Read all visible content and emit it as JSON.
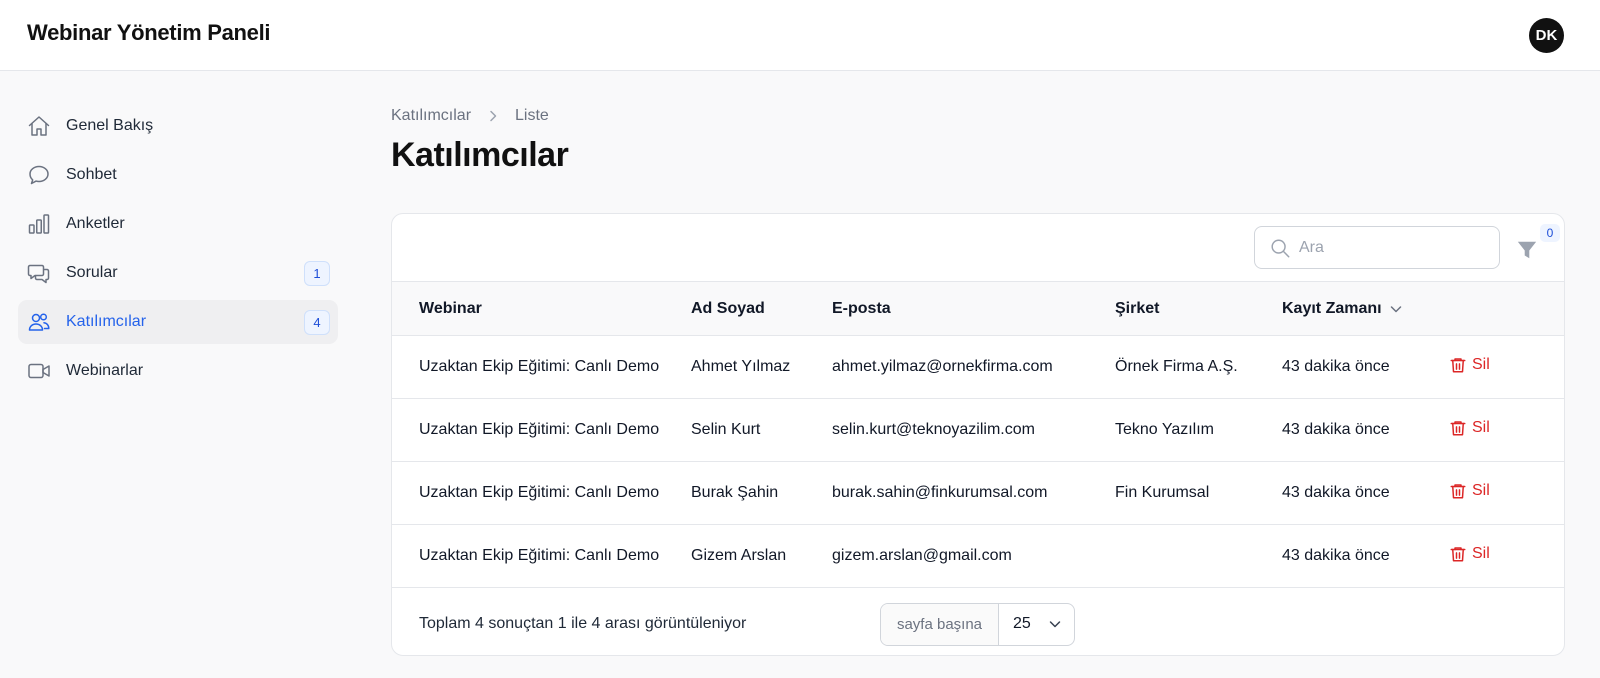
{
  "app": {
    "title": "Webinar Yönetim Paneli",
    "avatar_initials": "DK"
  },
  "sidebar": {
    "items": [
      {
        "label": "Genel Bakış",
        "icon": "home-icon",
        "badge": null
      },
      {
        "label": "Sohbet",
        "icon": "chat-bubble-icon",
        "badge": null
      },
      {
        "label": "Anketler",
        "icon": "bar-chart-icon",
        "badge": null
      },
      {
        "label": "Sorular",
        "icon": "question-chat-icon",
        "badge": "1"
      },
      {
        "label": "Katılımcılar",
        "icon": "users-icon",
        "badge": "4",
        "active": true
      },
      {
        "label": "Webinarlar",
        "icon": "video-camera-icon",
        "badge": null
      }
    ]
  },
  "breadcrumb": {
    "parent": "Katılımcılar",
    "current": "Liste"
  },
  "page": {
    "title": "Katılımcılar"
  },
  "toolbar": {
    "search_placeholder": "Ara",
    "search_value": "",
    "filter_count": "0"
  },
  "table": {
    "columns": {
      "webinar": "Webinar",
      "name": "Ad Soyad",
      "email": "E-posta",
      "company": "Şirket",
      "registered": "Kayıt Zamanı"
    },
    "sorted_by": "registered",
    "delete_label": "Sil",
    "rows": [
      {
        "webinar": "Uzaktan Ekip Eğitimi: Canlı Demo",
        "name": "Ahmet Yılmaz",
        "email": "ahmet.yilmaz@ornekfirma.com",
        "company": "Örnek Firma A.Ş.",
        "registered": "43 dakika önce"
      },
      {
        "webinar": "Uzaktan Ekip Eğitimi: Canlı Demo",
        "name": "Selin Kurt",
        "email": "selin.kurt@teknoyazilim.com",
        "company": "Tekno Yazılım",
        "registered": "43 dakika önce"
      },
      {
        "webinar": "Uzaktan Ekip Eğitimi: Canlı Demo",
        "name": "Burak Şahin",
        "email": "burak.sahin@finkurumsal.com",
        "company": "Fin Kurumsal",
        "registered": "43 dakika önce"
      },
      {
        "webinar": "Uzaktan Ekip Eğitimi: Canlı Demo",
        "name": "Gizem Arslan",
        "email": "gizem.arslan@gmail.com",
        "company": "",
        "registered": "43 dakika önce"
      }
    ]
  },
  "pagination": {
    "summary": "Toplam 4 sonuçtan 1 ile 4 arası görüntüleniyor",
    "per_page_label": "sayfa başına",
    "per_page_value": "25"
  },
  "colors": {
    "accent": "#2563eb",
    "danger": "#dc2626",
    "badge_bg": "#eef4ff"
  }
}
